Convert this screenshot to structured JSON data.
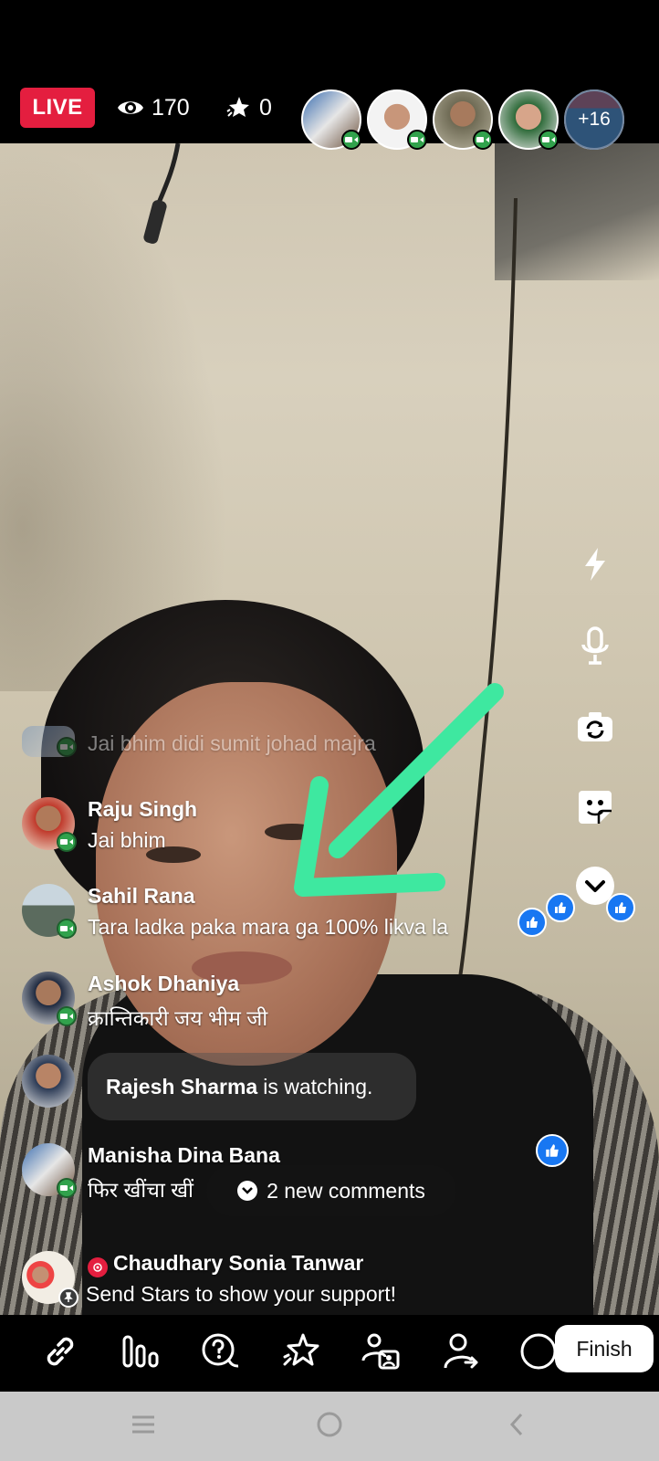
{
  "live_badge": "LIVE",
  "viewers": "170",
  "stars": "0",
  "more_participants": "+16",
  "comments": [
    {
      "name": "",
      "text": "Jai bhim didi sumit johad majra",
      "faded": true
    },
    {
      "name": "Raju Singh",
      "text": "Jai bhim"
    },
    {
      "name": "Sahil Rana",
      "text": "Tara ladka paka mara ga 100%  likva la"
    },
    {
      "name": "Ashok Dhaniya",
      "text": "क्रान्तिकारी जय भीम जी"
    },
    {
      "name": "Manisha Dina Bana",
      "text": "फिर खींचा खीं"
    },
    {
      "name": "Chaudhary Sonia Tanwar",
      "text": "Send Stars to show your support!"
    }
  ],
  "watching": {
    "name": "Rajesh Sharma",
    "suffix": "is watching."
  },
  "new_comments": "2 new comments",
  "finish_label": "Finish",
  "colors": {
    "live_red": "#e41e3f",
    "video_green": "#31a24c",
    "like_blue": "#1877f2",
    "arrow_green": "#3ee8a0"
  },
  "icons": {
    "top": [
      "eye-icon",
      "stars-icon"
    ],
    "rail": [
      "flash-icon",
      "microphone-icon",
      "flip-camera-icon",
      "sticker-icon",
      "chevron-down-icon"
    ],
    "toolbar": [
      "link-icon",
      "poll-icon",
      "question-icon",
      "stars-icon",
      "guest-icon",
      "invite-icon",
      "circle-icon"
    ],
    "nav": [
      "recents-icon",
      "home-icon",
      "back-icon"
    ]
  }
}
